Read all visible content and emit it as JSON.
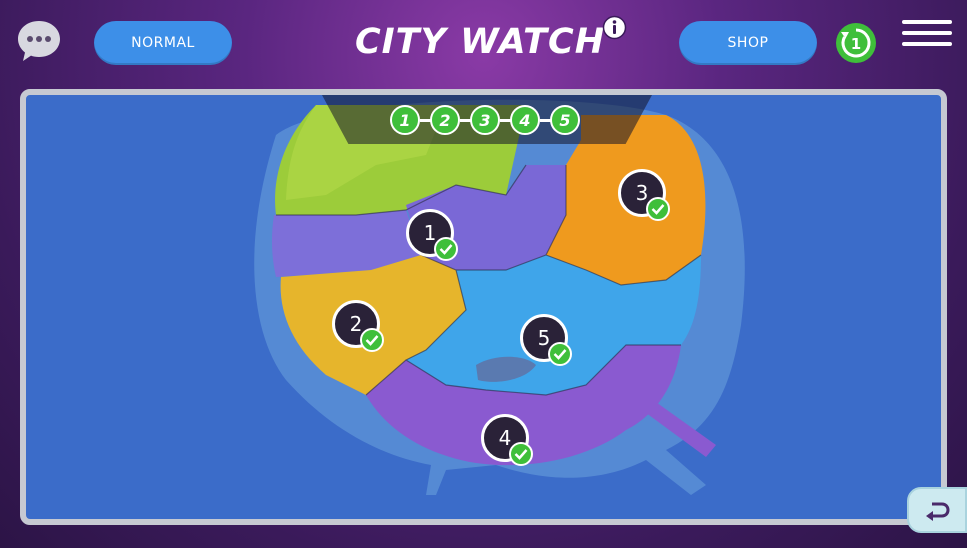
{
  "header": {
    "title": "CITY WATCH",
    "mode_button": "NORMAL",
    "shop_button": "SHOP",
    "level_badge": "1"
  },
  "icons": {
    "chat": "chat-bubble-icon",
    "info": "info-icon",
    "level": "level-refresh-icon",
    "menu": "hamburger-menu-icon",
    "back": "back-arrow-icon",
    "check": "checkmark-icon"
  },
  "progress_steps": [
    "1",
    "2",
    "3",
    "4",
    "5"
  ],
  "markers": [
    {
      "label": "1",
      "completed": true
    },
    {
      "label": "2",
      "completed": true
    },
    {
      "label": "3",
      "completed": true
    },
    {
      "label": "4",
      "completed": true
    },
    {
      "label": "5",
      "completed": true
    }
  ],
  "colors": {
    "accent_blue": "#3d8fe8",
    "complete_green": "#3fbf3a",
    "ocean": "#3b6cc9",
    "district_green": "#9ccc3a",
    "district_purple": "#7a68d6",
    "district_orange": "#ef9a1e",
    "district_yellow": "#e6b52c",
    "district_blue": "#3fa5ea",
    "district_violet": "#8a5ad0"
  }
}
